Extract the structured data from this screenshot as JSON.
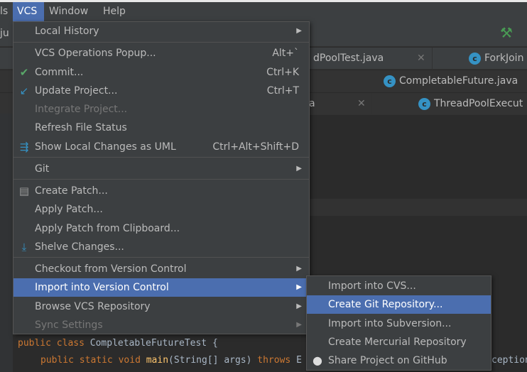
{
  "menubar": {
    "items": [
      "ls",
      "VCS",
      "Window",
      "Help"
    ],
    "active": "VCS"
  },
  "toolbar": {
    "project_fragment": "ju"
  },
  "tabs": {
    "row1": [
      {
        "label": "dPoolTest.java"
      },
      {
        "label": "ForkJoin"
      }
    ],
    "row2": [
      {
        "label": "CompletableFuture.java"
      }
    ],
    "row3": [
      {
        "label": "a"
      },
      {
        "label": "ThreadPoolExecut"
      }
    ]
  },
  "vcs_menu": {
    "items": [
      {
        "label": "Local History",
        "submenu": true
      },
      {
        "label": "VCS Operations Popup...",
        "shortcut": "Alt+`"
      },
      {
        "label": "Commit...",
        "shortcut": "Ctrl+K",
        "icon": "check-icon"
      },
      {
        "label": "Update Project...",
        "shortcut": "Ctrl+T",
        "icon": "update-arrow-icon"
      },
      {
        "label": "Integrate Project...",
        "disabled": true
      },
      {
        "label": "Refresh File Status"
      },
      {
        "label": "Show Local Changes as UML",
        "shortcut": "Ctrl+Alt+Shift+D",
        "icon": "uml-icon"
      },
      {
        "label": "Git",
        "submenu": true
      },
      {
        "label": "Create Patch...",
        "icon": "patch-icon"
      },
      {
        "label": "Apply Patch..."
      },
      {
        "label": "Apply Patch from Clipboard..."
      },
      {
        "label": "Shelve Changes...",
        "icon": "shelve-icon"
      },
      {
        "label": "Checkout from Version Control",
        "submenu": true
      },
      {
        "label": "Import into Version Control",
        "submenu": true,
        "selected": true
      },
      {
        "label": "Browse VCS Repository",
        "submenu": true
      },
      {
        "label": "Sync Settings",
        "submenu": true,
        "disabled": true
      }
    ]
  },
  "import_submenu": {
    "items": [
      {
        "label": "Import into CVS..."
      },
      {
        "label": "Create Git Repository...",
        "selected": true
      },
      {
        "label": "Import into Subversion..."
      },
      {
        "label": "Create Mercurial Repository"
      },
      {
        "label": "Share Project on GitHub",
        "icon": "github-icon"
      }
    ]
  },
  "code": {
    "line1": {
      "kw1": "public",
      "kw2": "class",
      "name": "CompletableFutureTest",
      "brace": "{"
    },
    "line2": {
      "kw1": "public",
      "kw2": "static",
      "kw3": "void",
      "fn": "main",
      "args": "(String[] args)",
      "kw4": "throws",
      "rest": "E",
      "tail": "ception"
    }
  },
  "colors": {
    "menu_bg": "#3c3f41",
    "selection": "#4b6eaf",
    "editor_bg": "#2b2b2b",
    "keyword": "#cc7832"
  }
}
